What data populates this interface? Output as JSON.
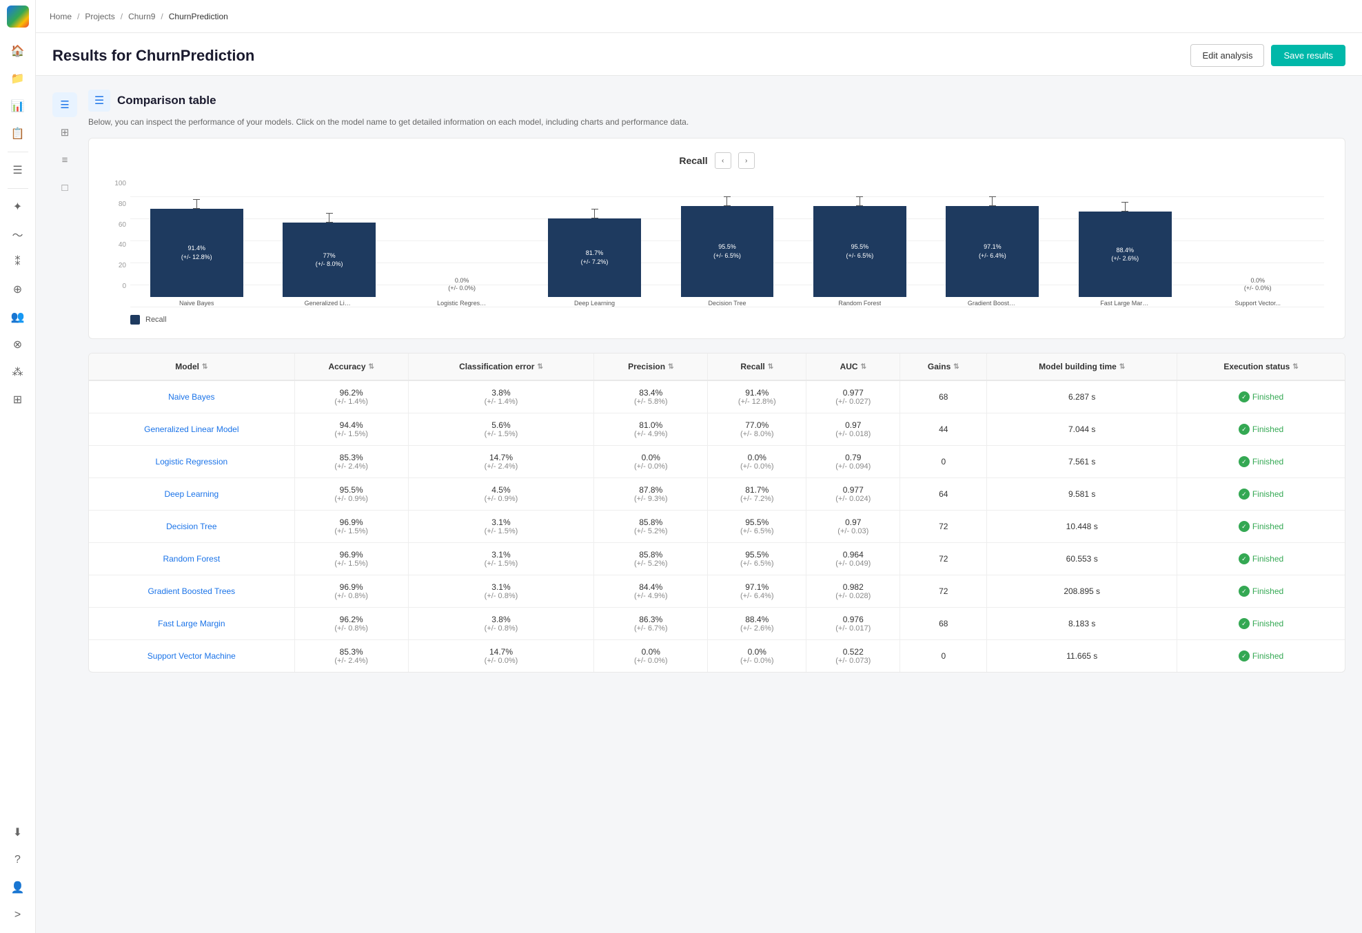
{
  "app": {
    "logo_alt": "App Logo"
  },
  "breadcrumb": {
    "items": [
      "Home",
      "Projects",
      "Churn9",
      "ChurnPrediction"
    ]
  },
  "page": {
    "title": "Results for ChurnPrediction",
    "edit_label": "Edit analysis",
    "save_label": "Save results"
  },
  "section": {
    "title": "Comparison table",
    "description": "Below, you can inspect the performance of your models. Click on the model name to get detailed information on each model, including charts and performance data."
  },
  "chart": {
    "title": "Recall",
    "legend_label": "Recall",
    "y_axis": [
      "100",
      "80",
      "60",
      "40",
      "20",
      "0"
    ],
    "bars": [
      {
        "label": "Naive Bayes",
        "label_short": "Naive Bayes",
        "value": 91.4,
        "sub": "(+/- 12.8%)",
        "display": "91.4%\n(+/- 12.8%)",
        "height_pct": 91.4
      },
      {
        "label": "Generalized Linear...",
        "label_short": "Generalized Linear...",
        "value": 77.0,
        "sub": "(+/- 8.0%)",
        "display": "77.0%\n(+/- 8.0%)",
        "height_pct": 77.0
      },
      {
        "label": "Logistic Regression",
        "label_short": "Logistic Regression",
        "value": 0.0,
        "sub": "(+/- 0.0%)",
        "display": "0.0%\n(+/- 0.0%)",
        "height_pct": 0,
        "top_label": "0.0%\n(+/- 0.0%)"
      },
      {
        "label": "Deep Learning",
        "label_short": "Deep Learning",
        "value": 81.7,
        "sub": "(+/- 7.2%)",
        "display": "81.7%\n(+/- 7.2%)",
        "height_pct": 81.7
      },
      {
        "label": "Decision Tree",
        "label_short": "Decision Tree",
        "value": 95.5,
        "sub": "(+/- 6.5%)",
        "display": "95.5%\n(+/- 6.5%)",
        "height_pct": 95.5
      },
      {
        "label": "Random Forest",
        "label_short": "Random Forest",
        "value": 95.5,
        "sub": "(+/- 6.5%)",
        "display": "95.5%\n(+/- 6.5%)",
        "height_pct": 95.5
      },
      {
        "label": "Gradient Boosted...",
        "label_short": "Gradient Boosted...",
        "value": 97.1,
        "sub": "(+/- 6.4%)",
        "display": "97.1%\n(+/- 6.4%)",
        "height_pct": 97.1
      },
      {
        "label": "Fast Large Margin",
        "label_short": "Fast Large Margin",
        "value": 88.4,
        "sub": "(+/- 2.6%)",
        "display": "88.4%\n(+/- 2.6%)",
        "height_pct": 88.4
      },
      {
        "label": "Support Vector...",
        "label_short": "Support Vector...",
        "value": 0.0,
        "sub": "(+/- 0.0%)",
        "display": "0.0%\n(+/- 0.0%)",
        "height_pct": 0,
        "top_label": "0.0%\n(+/- 0.0%)"
      }
    ]
  },
  "table": {
    "columns": [
      "Model",
      "Accuracy",
      "Classification error",
      "Precision",
      "Recall",
      "AUC",
      "Gains",
      "Model building time",
      "Execution status"
    ],
    "rows": [
      {
        "model": "Naive Bayes",
        "accuracy": "96.2%",
        "accuracy_sub": "(+/- 1.4%)",
        "class_error": "3.8%",
        "class_error_sub": "(+/- 1.4%)",
        "precision": "83.4%",
        "precision_sub": "(+/- 5.8%)",
        "recall": "91.4%",
        "recall_sub": "(+/- 12.8%)",
        "auc": "0.977",
        "auc_sub": "(+/- 0.027)",
        "gains": "68",
        "build_time": "6.287 s",
        "status": "Finished"
      },
      {
        "model": "Generalized Linear Model",
        "accuracy": "94.4%",
        "accuracy_sub": "(+/- 1.5%)",
        "class_error": "5.6%",
        "class_error_sub": "(+/- 1.5%)",
        "precision": "81.0%",
        "precision_sub": "(+/- 4.9%)",
        "recall": "77.0%",
        "recall_sub": "(+/- 8.0%)",
        "auc": "0.97",
        "auc_sub": "(+/- 0.018)",
        "gains": "44",
        "build_time": "7.044 s",
        "status": "Finished"
      },
      {
        "model": "Logistic Regression",
        "accuracy": "85.3%",
        "accuracy_sub": "(+/- 2.4%)",
        "class_error": "14.7%",
        "class_error_sub": "(+/- 2.4%)",
        "precision": "0.0%",
        "precision_sub": "(+/- 0.0%)",
        "recall": "0.0%",
        "recall_sub": "(+/- 0.0%)",
        "auc": "0.79",
        "auc_sub": "(+/- 0.094)",
        "gains": "0",
        "build_time": "7.561 s",
        "status": "Finished"
      },
      {
        "model": "Deep Learning",
        "accuracy": "95.5%",
        "accuracy_sub": "(+/- 0.9%)",
        "class_error": "4.5%",
        "class_error_sub": "(+/- 0.9%)",
        "precision": "87.8%",
        "precision_sub": "(+/- 9.3%)",
        "recall": "81.7%",
        "recall_sub": "(+/- 7.2%)",
        "auc": "0.977",
        "auc_sub": "(+/- 0.024)",
        "gains": "64",
        "build_time": "9.581 s",
        "status": "Finished"
      },
      {
        "model": "Decision Tree",
        "accuracy": "96.9%",
        "accuracy_sub": "(+/- 1.5%)",
        "class_error": "3.1%",
        "class_error_sub": "(+/- 1.5%)",
        "precision": "85.8%",
        "precision_sub": "(+/- 5.2%)",
        "recall": "95.5%",
        "recall_sub": "(+/- 6.5%)",
        "auc": "0.97",
        "auc_sub": "(+/- 0.03)",
        "gains": "72",
        "build_time": "10.448 s",
        "status": "Finished"
      },
      {
        "model": "Random Forest",
        "accuracy": "96.9%",
        "accuracy_sub": "(+/- 1.5%)",
        "class_error": "3.1%",
        "class_error_sub": "(+/- 1.5%)",
        "precision": "85.8%",
        "precision_sub": "(+/- 5.2%)",
        "recall": "95.5%",
        "recall_sub": "(+/- 6.5%)",
        "auc": "0.964",
        "auc_sub": "(+/- 0.049)",
        "gains": "72",
        "build_time": "60.553 s",
        "status": "Finished"
      },
      {
        "model": "Gradient Boosted Trees",
        "accuracy": "96.9%",
        "accuracy_sub": "(+/- 0.8%)",
        "class_error": "3.1%",
        "class_error_sub": "(+/- 0.8%)",
        "precision": "84.4%",
        "precision_sub": "(+/- 4.9%)",
        "recall": "97.1%",
        "recall_sub": "(+/- 6.4%)",
        "auc": "0.982",
        "auc_sub": "(+/- 0.028)",
        "gains": "72",
        "build_time": "208.895 s",
        "status": "Finished"
      },
      {
        "model": "Fast Large Margin",
        "accuracy": "96.2%",
        "accuracy_sub": "(+/- 0.8%)",
        "class_error": "3.8%",
        "class_error_sub": "(+/- 0.8%)",
        "precision": "86.3%",
        "precision_sub": "(+/- 6.7%)",
        "recall": "88.4%",
        "recall_sub": "(+/- 2.6%)",
        "auc": "0.976",
        "auc_sub": "(+/- 0.017)",
        "gains": "68",
        "build_time": "8.183 s",
        "status": "Finished"
      },
      {
        "model": "Support Vector Machine",
        "accuracy": "85.3%",
        "accuracy_sub": "(+/- 2.4%)",
        "class_error": "14.7%",
        "class_error_sub": "(+/- 0.0%)",
        "precision": "0.0%",
        "precision_sub": "(+/- 0.0%)",
        "recall": "0.0%",
        "recall_sub": "(+/- 0.0%)",
        "auc": "0.522",
        "auc_sub": "(+/- 0.073)",
        "gains": "0",
        "build_time": "11.665 s",
        "status": "Finished"
      }
    ]
  },
  "sidebar": {
    "icons": [
      "home",
      "folder",
      "chart-bar",
      "table",
      "filter",
      "network",
      "wave",
      "cluster",
      "tree",
      "person-group",
      "link",
      "scatter",
      "connection",
      "download",
      "help",
      "person"
    ]
  }
}
